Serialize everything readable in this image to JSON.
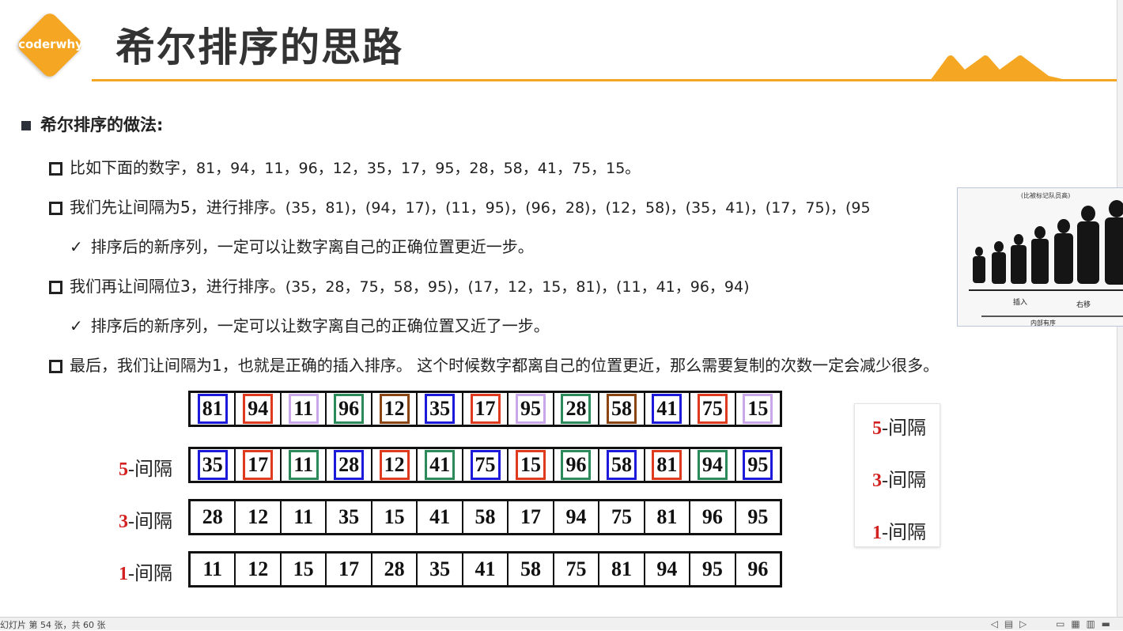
{
  "header": {
    "logo_text": "coderwhy",
    "title": "希尔排序的思路",
    "accent_color": "#f5a623"
  },
  "section_heading": "希尔排序的做法:",
  "rows": [
    {
      "text": "比如下面的数字，",
      "nums": "81，94，11，96，12，35，17，95，28，58，41，75，15。"
    },
    {
      "text": "我们先让间隔为5，进行排序。",
      "nums": "(35，81)，(94，17)，(11，95)，(96，28)，(12，58)，(35，41)，(17，75)，(95"
    },
    {
      "check": "排序后的新序列，一定可以让数字离自己的正确位置更近一步。"
    },
    {
      "text": "我们再让间隔位3，进行排序。",
      "nums": "(35，28，75，58，95)，(17，12，15，81)，(11，41，96，94)"
    },
    {
      "check": "排序后的新序列，一定可以让数字离自己的正确位置又近了一步。"
    },
    {
      "text": "最后，我们让间隔为1，也就是正确的插入排序。 这个时候数字都离自己的位置更近，那么需要复制的次数一定会减少很多。"
    }
  ],
  "tables": {
    "original": [
      {
        "v": "81",
        "c": "#1a1ad8"
      },
      {
        "v": "94",
        "c": "#e03a1e"
      },
      {
        "v": "11",
        "c": "#c9a7e8"
      },
      {
        "v": "96",
        "c": "#2a8a5a"
      },
      {
        "v": "12",
        "c": "#8b4513"
      },
      {
        "v": "35",
        "c": "#1a1ad8"
      },
      {
        "v": "17",
        "c": "#e03a1e"
      },
      {
        "v": "95",
        "c": "#c9a7e8"
      },
      {
        "v": "28",
        "c": "#2a8a5a"
      },
      {
        "v": "58",
        "c": "#8b4513"
      },
      {
        "v": "41",
        "c": "#1a1ad8"
      },
      {
        "v": "75",
        "c": "#e03a1e"
      },
      {
        "v": "15",
        "c": "#c9a7e8"
      }
    ],
    "gap5": [
      {
        "v": "35",
        "c": "#1a1ad8"
      },
      {
        "v": "17",
        "c": "#e03a1e"
      },
      {
        "v": "11",
        "c": "#2a8a5a"
      },
      {
        "v": "28",
        "c": "#1a1ad8"
      },
      {
        "v": "12",
        "c": "#e03a1e"
      },
      {
        "v": "41",
        "c": "#2a8a5a"
      },
      {
        "v": "75",
        "c": "#1a1ad8"
      },
      {
        "v": "15",
        "c": "#e03a1e"
      },
      {
        "v": "96",
        "c": "#2a8a5a"
      },
      {
        "v": "58",
        "c": "#1a1ad8"
      },
      {
        "v": "81",
        "c": "#e03a1e"
      },
      {
        "v": "94",
        "c": "#2a8a5a"
      },
      {
        "v": "95",
        "c": "#1a1ad8"
      }
    ],
    "gap3": [
      "28",
      "12",
      "11",
      "35",
      "15",
      "41",
      "58",
      "17",
      "94",
      "75",
      "81",
      "96",
      "95"
    ],
    "gap1": [
      "11",
      "12",
      "15",
      "17",
      "28",
      "35",
      "41",
      "58",
      "75",
      "81",
      "94",
      "95",
      "96"
    ]
  },
  "gap_labels": {
    "gap5": {
      "n": "5",
      "t": "-间隔"
    },
    "gap3": {
      "n": "3",
      "t": "-间隔"
    },
    "gap1": {
      "n": "1",
      "t": "-间隔"
    }
  },
  "legend": [
    {
      "n": "5",
      "t": "-间隔"
    },
    {
      "n": "3",
      "t": "-间隔"
    },
    {
      "n": "1",
      "t": "-间隔"
    }
  ],
  "photo": {
    "caption_top": "(比被标记队员高)",
    "label_insert": "插入",
    "label_shift": "右移",
    "label_bottom": "内部有序"
  },
  "status": {
    "slide_text": "幻灯片 第 54 张，共 60 张"
  }
}
